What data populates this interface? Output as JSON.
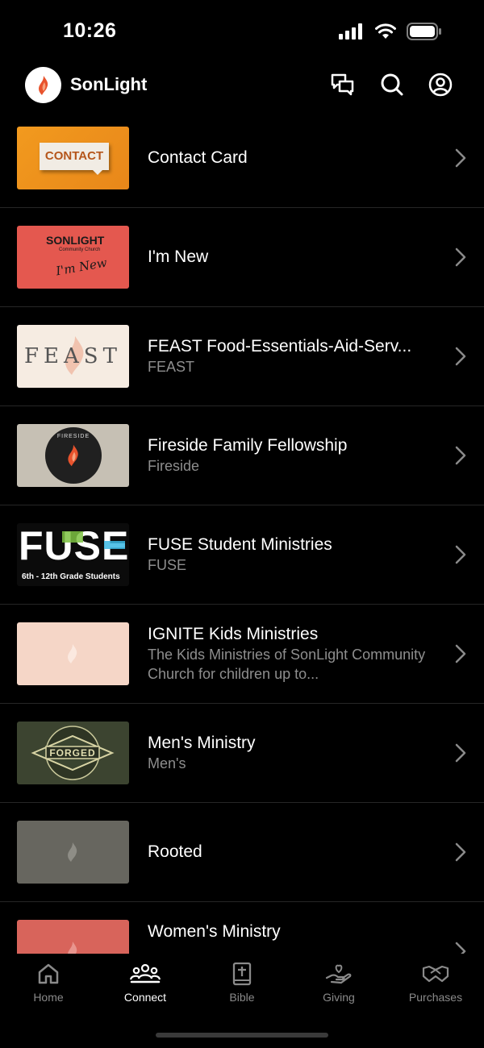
{
  "status": {
    "time": "10:26"
  },
  "header": {
    "app_name": "SonLight"
  },
  "list": [
    {
      "title": "Contact Card",
      "subtitle": "",
      "thumb_text": "CONTACT"
    },
    {
      "title": "I'm New",
      "subtitle": "",
      "thumb_text": "SONLIGHT",
      "thumb_subtext": "Community Church",
      "thumb_script": "I'm New"
    },
    {
      "title": "FEAST Food-Essentials-Aid-Serv...",
      "subtitle": "FEAST",
      "thumb_text": "FEAST"
    },
    {
      "title": "Fireside Family Fellowship",
      "subtitle": "Fireside",
      "thumb_text": "FIRESIDE"
    },
    {
      "title": "FUSE Student Ministries",
      "subtitle": "FUSE",
      "thumb_text": "FUSE",
      "thumb_subtext": "6th - 12th Grade Students"
    },
    {
      "title": "IGNITE Kids Ministries",
      "subtitle": "The Kids Ministries of SonLight Community Church for children up to..."
    },
    {
      "title": "Men's Ministry",
      "subtitle": "Men's",
      "thumb_text": "FORGED"
    },
    {
      "title": "Rooted",
      "subtitle": ""
    },
    {
      "title": "Women's Ministry",
      "subtitle": ""
    }
  ],
  "tabs": [
    {
      "label": "Home",
      "icon": "home-icon",
      "active": false
    },
    {
      "label": "Connect",
      "icon": "people-icon",
      "active": true
    },
    {
      "label": "Bible",
      "icon": "bible-icon",
      "active": false
    },
    {
      "label": "Giving",
      "icon": "giving-icon",
      "active": false
    },
    {
      "label": "Purchases",
      "icon": "handshake-icon",
      "active": false
    }
  ],
  "colors": {
    "background": "#000000",
    "separator": "#262626",
    "subtitle": "#8e8e8e",
    "tab_inactive": "#8a8a8a",
    "flame": "#e8532d"
  }
}
